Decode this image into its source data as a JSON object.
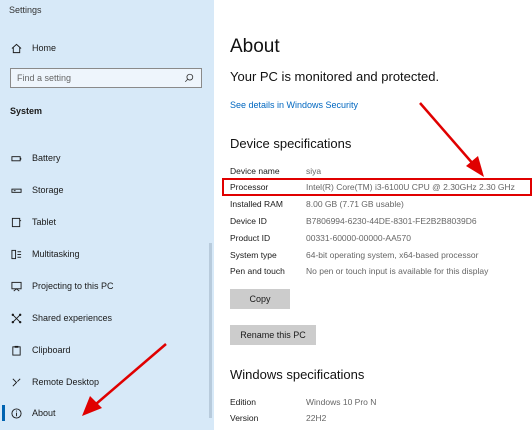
{
  "window": {
    "title": "Settings"
  },
  "sidebar": {
    "home_label": "Home",
    "search_placeholder": "Find a setting",
    "section": "System",
    "items": [
      {
        "label": "Battery",
        "icon": "battery-icon"
      },
      {
        "label": "Storage",
        "icon": "storage-icon"
      },
      {
        "label": "Tablet",
        "icon": "tablet-icon"
      },
      {
        "label": "Multitasking",
        "icon": "multitasking-icon"
      },
      {
        "label": "Projecting to this PC",
        "icon": "projecting-icon"
      },
      {
        "label": "Shared experiences",
        "icon": "shared-experiences-icon"
      },
      {
        "label": "Clipboard",
        "icon": "clipboard-icon"
      },
      {
        "label": "Remote Desktop",
        "icon": "remote-desktop-icon"
      },
      {
        "label": "About",
        "icon": "info-icon",
        "active": true
      }
    ]
  },
  "main": {
    "title": "About",
    "status": "Your PC is monitored and protected.",
    "security_link": "See details in Windows Security",
    "device_specs_heading": "Device specifications",
    "device_specs": [
      {
        "key": "Device name",
        "value": "siya"
      },
      {
        "key": "Processor",
        "value": "Intel(R) Core(TM) i3-6100U CPU @ 2.30GHz   2.30 GHz"
      },
      {
        "key": "Installed RAM",
        "value": "8.00 GB (7.71 GB usable)"
      },
      {
        "key": "Device ID",
        "value": "B7806994-6230-44DE-8301-FE2B2B8039D6"
      },
      {
        "key": "Product ID",
        "value": "00331-60000-00000-AA570"
      },
      {
        "key": "System type",
        "value": "64-bit operating system, x64-based processor"
      },
      {
        "key": "Pen and touch",
        "value": "No pen or touch input is available for this display"
      }
    ],
    "copy_button": "Copy",
    "rename_button": "Rename this PC",
    "windows_specs_heading": "Windows specifications",
    "windows_specs": [
      {
        "key": "Edition",
        "value": "Windows 10 Pro N"
      },
      {
        "key": "Version",
        "value": "22H2"
      }
    ]
  },
  "colors": {
    "sidebar_bg": "#d7e9f8",
    "accent": "#0063b1",
    "link": "#0067c0",
    "highlight": "#e00000"
  }
}
